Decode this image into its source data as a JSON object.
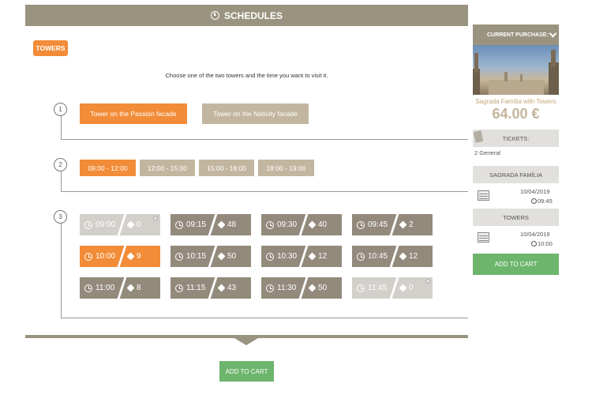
{
  "header": {
    "title": "SCHEDULES",
    "icon": "clock-icon"
  },
  "category_tag": "TOWERS",
  "instruction": "Choose one of the two towers and the time you want to visit it.",
  "steps": {
    "one": "1",
    "two": "2",
    "three": "3"
  },
  "tower_options": [
    {
      "label": "Tower on the Passion facade",
      "selected": true
    },
    {
      "label": "Tower on the Nativity facade",
      "selected": false
    }
  ],
  "time_ranges": [
    {
      "label": "09:00 - 12:00",
      "selected": true
    },
    {
      "label": "12:00 - 15:00",
      "selected": false
    },
    {
      "label": "15:00 - 18:00",
      "selected": false
    },
    {
      "label": "18:00 - 19:00",
      "selected": false
    }
  ],
  "slots": [
    {
      "time": "09:00",
      "count": "0",
      "state": "unavailable"
    },
    {
      "time": "09:15",
      "count": "48",
      "state": "available"
    },
    {
      "time": "09:30",
      "count": "40",
      "state": "available"
    },
    {
      "time": "09:45",
      "count": "2",
      "state": "available"
    },
    {
      "time": "10:00",
      "count": "9",
      "state": "selected"
    },
    {
      "time": "10:15",
      "count": "50",
      "state": "available"
    },
    {
      "time": "10:30",
      "count": "12",
      "state": "available"
    },
    {
      "time": "10:45",
      "count": "12",
      "state": "available"
    },
    {
      "time": "11:00",
      "count": "8",
      "state": "available"
    },
    {
      "time": "11:15",
      "count": "43",
      "state": "available"
    },
    {
      "time": "11:30",
      "count": "50",
      "state": "available"
    },
    {
      "time": "11:45",
      "count": "0",
      "state": "unavailable"
    }
  ],
  "add_to_cart_main": "ADD TO CART",
  "sidebar": {
    "header": "CURRENT PURCHASE:",
    "product": "Sagrada Família with Towers",
    "price": "64.00 €",
    "tickets_label": "TICKETS:",
    "tickets_value": "2 General",
    "section1": {
      "title": "SAGRADA FAMÍLIA",
      "date": "10/04/2019",
      "time": "09:45"
    },
    "section2": {
      "title": "TOWERS",
      "date": "10/04/2019",
      "time": "10:00"
    },
    "add_to_cart": "ADD TO CART"
  },
  "colors": {
    "accent": "#f28c38",
    "header": "#9a9380",
    "cart": "#6db56d",
    "slot_dark": "#938a7c",
    "slot_disabled": "#d3d0cb",
    "range_tan": "#c3b6a0"
  }
}
